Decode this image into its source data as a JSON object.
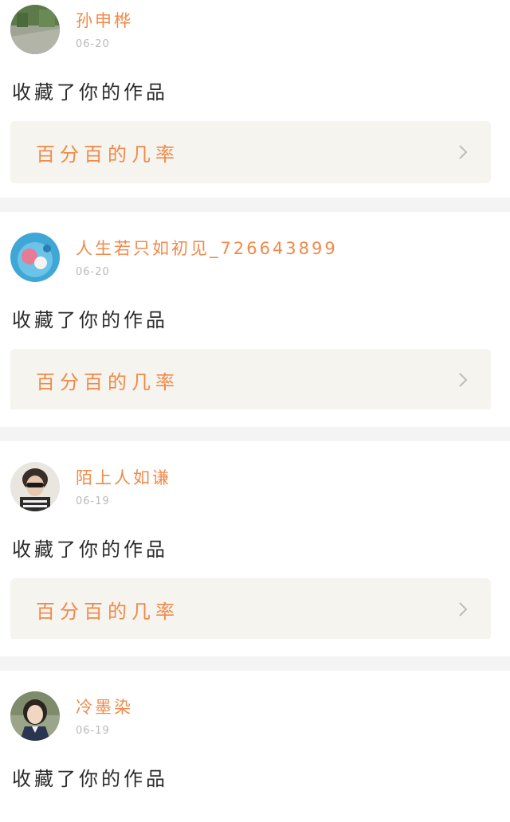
{
  "notifications": [
    {
      "username": "孙申桦",
      "date": "06-20",
      "action": "收藏了你的作品",
      "work_title": "百分百的几率",
      "avatar": "avatar-outdoor-photo"
    },
    {
      "username": "人生若只如初见_726643899",
      "date": "06-20",
      "action": "收藏了你的作品",
      "work_title": "百分百的几率",
      "avatar": "avatar-blue-cartoon"
    },
    {
      "username": "陌上人如谦",
      "date": "06-19",
      "action": "收藏了你的作品",
      "work_title": "百分百的几率",
      "avatar": "avatar-man-sunglasses"
    },
    {
      "username": "冷墨染",
      "date": "06-19",
      "action": "收藏了你的作品",
      "work_title": "",
      "avatar": "avatar-girl-uniform"
    }
  ],
  "colors": {
    "accent": "#f08a4b",
    "card_box": "#f5f4ee",
    "separator": "#f4f4f4",
    "date_text": "#b9b9b9"
  }
}
